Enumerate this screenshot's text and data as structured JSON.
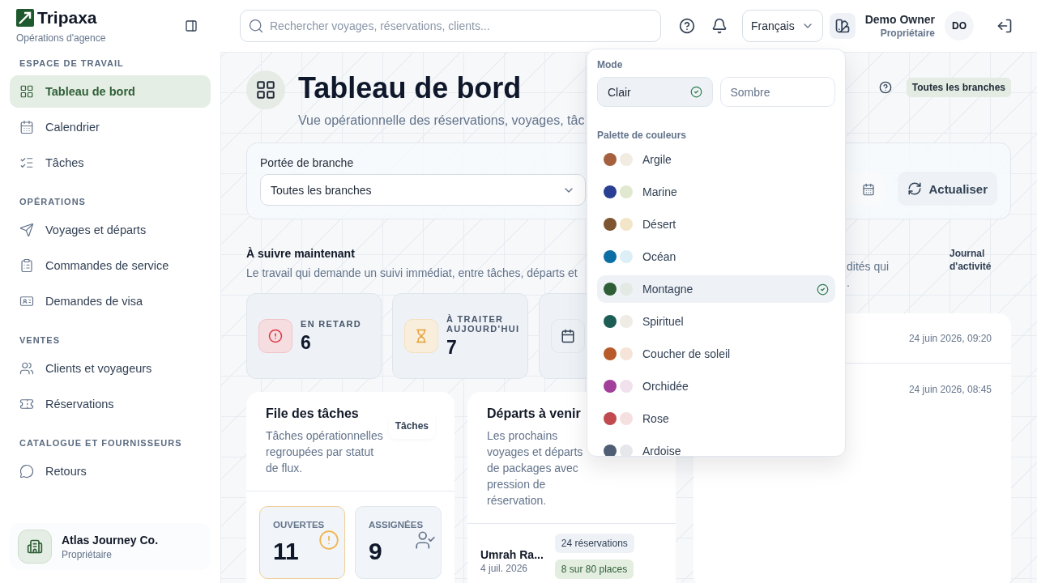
{
  "brand": {
    "name": "Tripaxa",
    "subtitle": "Opérations d'agence"
  },
  "sidebar": {
    "sections": [
      {
        "heading": "ESPACE DE TRAVAIL",
        "items": [
          {
            "label": "Tableau de bord",
            "selected": true
          },
          {
            "label": "Calendrier",
            "selected": false
          },
          {
            "label": "Tâches",
            "selected": false
          }
        ]
      },
      {
        "heading": "OPÉRATIONS",
        "items": [
          {
            "label": "Voyages et départs",
            "selected": false
          },
          {
            "label": "Commandes de service",
            "selected": false
          },
          {
            "label": "Demandes de visa",
            "selected": false
          }
        ]
      },
      {
        "heading": "VENTES",
        "items": [
          {
            "label": "Clients et voyageurs",
            "selected": false
          },
          {
            "label": "Réservations",
            "selected": false
          }
        ]
      },
      {
        "heading": "CATALOGUE ET FOURNISSEURS",
        "items": [
          {
            "label": "Retours",
            "selected": false
          }
        ]
      }
    ]
  },
  "organization": {
    "name": "Atlas Journey Co.",
    "role": "Propriétaire"
  },
  "topbar": {
    "search": {
      "placeholder": "Rechercher voyages, réservations, clients..."
    },
    "language": "Français",
    "user": {
      "name": "Demo Owner",
      "role": "Propriétaire",
      "initials": "DO"
    }
  },
  "header": {
    "title": "Tableau de bord",
    "subtitle": "Vue opérationnelle des réservations, voyages, tâc",
    "badge": "Toutes les branches"
  },
  "filters": {
    "scope_label": "Portée de branche",
    "scope_value": "Toutes les branches",
    "refresh": "Actualiser"
  },
  "follow_up": {
    "title": "À suivre maintenant",
    "description": "Le travail qui demande un suivi immédiat, entre tâches, départs et",
    "stats": [
      {
        "kind": "overdue",
        "label": "EN RETARD",
        "value": "6"
      },
      {
        "kind": "today",
        "label": "À TRAITER AUJOURD'HUI",
        "value": "7"
      },
      {
        "kind": "upcoming"
      }
    ]
  },
  "task_queue": {
    "title": "File des tâches",
    "link": "Tâches",
    "description": "Tâches opérationnelles regroupées par statut de flux.",
    "stats": [
      {
        "kind": "open",
        "label": "OUVERTES",
        "value": "11"
      },
      {
        "kind": "assigned",
        "label": "ASSIGNÉES",
        "value": "9"
      }
    ]
  },
  "departures": {
    "title": "Départs à venir",
    "description": "Les prochains voyages et départs de packages avec pression de réservation.",
    "rows": [
      {
        "name": "Umrah Ra...",
        "date": "4 juil. 2026",
        "bookings": "24 réservations",
        "seats": "8 sur 80 places"
      }
    ]
  },
  "activity": {
    "description": [
      "dités qui",
      "."
    ],
    "link": "Journal d'activité",
    "entries": [
      {
        "time": "24 juin 2026, 09:20"
      },
      {
        "time": "24 juin 2026, 08:45"
      }
    ]
  },
  "theme_menu": {
    "mode_label": "Mode",
    "modes": [
      {
        "label": "Clair",
        "selected": true
      },
      {
        "label": "Sombre",
        "selected": false
      }
    ],
    "palette_label": "Palette de couleurs",
    "palettes": [
      {
        "name": "Argile",
        "swatches": [
          {
            "color": "#a5603f"
          },
          {
            "color": "#f2ebe2"
          }
        ],
        "selected": false
      },
      {
        "name": "Marine",
        "swatches": [
          {
            "color": "#2a3f94"
          },
          {
            "color": "#e0e8cf"
          }
        ],
        "selected": false
      },
      {
        "name": "Désert",
        "swatches": [
          {
            "color": "#7d5530"
          },
          {
            "color": "#f3e6c8"
          }
        ],
        "selected": false
      },
      {
        "name": "Océan",
        "swatches": [
          {
            "color": "#0b6fa6"
          },
          {
            "color": "#dceef6"
          }
        ],
        "selected": false
      },
      {
        "name": "Montagne",
        "swatches": [
          {
            "color": "#2e5e36"
          },
          {
            "color": "#e3e9e3"
          }
        ],
        "selected": true
      },
      {
        "name": "Spirituel",
        "swatches": [
          {
            "color": "#1c5e55"
          },
          {
            "color": "#efebe5"
          }
        ],
        "selected": false
      },
      {
        "name": "Coucher de soleil",
        "swatches": [
          {
            "color": "#b85a2a"
          },
          {
            "color": "#f6e4d8"
          }
        ],
        "selected": false
      },
      {
        "name": "Orchidée",
        "swatches": [
          {
            "color": "#a23f9b"
          },
          {
            "color": "#f1e1ef"
          }
        ],
        "selected": false
      },
      {
        "name": "Rose",
        "swatches": [
          {
            "color": "#c04a4e"
          },
          {
            "color": "#f5e0e0"
          }
        ],
        "selected": false
      },
      {
        "name": "Ardoise",
        "swatches": [
          {
            "color": "#4f5e74"
          },
          {
            "color": "#e5e7eb"
          }
        ],
        "selected": false
      }
    ]
  }
}
